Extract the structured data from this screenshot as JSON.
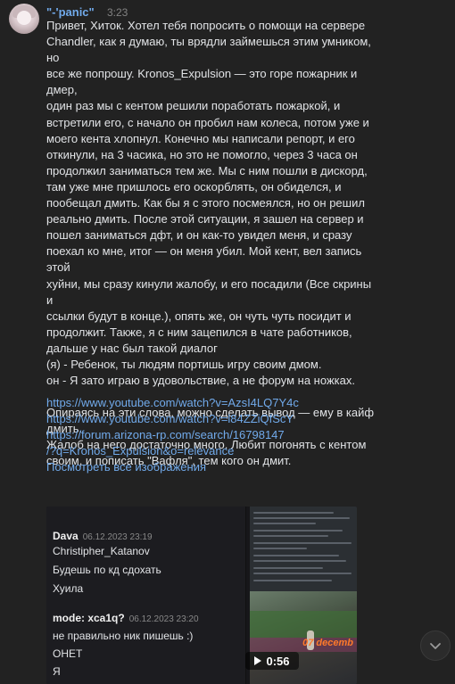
{
  "message": {
    "author": "\"-'panic\"",
    "time": "3:23",
    "paragraphs": [
      "Привет, Хиток. Хотел тебя попросить о помощи на сервере\nChandler, как я думаю, ты врядли займешься этим умником, но\nвсе же попрошу. Kronos_Expulsion — это горе пожарник и дмер,\nодин раз мы с кентом решили поработать пожаркой, и\nвстретили его, с начало он пробил нам колеса, потом уже и\nмоего кента хлопнул. Конечно мы написали репорт, и его\nоткинули, на 3 часика, но это не помогло, через 3 часа он\nпродолжил заниматься тем же. Мы с ним пошли в дискорд,\nтам уже мне пришлось его оскорблять, он обиделся, и\nпообещал дмить. Как бы я с этого посмеялся, но он решил\nреально дмить. После этой ситуации, я зашел на сервер и\nпошел заниматься дфт, и он как-то увидел меня, и сразу\nпоехал ко мне, итог — он меня убил. Мой кент, вел запись этой\nхуйни, мы сразу кинули жалобу, и его посадили (Все скрины и\nссылки будут в конце.), опять же, он чуть чуть посидит и\nпродолжит. Также, я с ним зацепился в чате работников,\nдальше у нас был такой диалог\n(я) - Ребенок, ты людям портишь игру своим дмом.\nон - Я зато играю в удовольствие, а не форум на ножках.",
      "Опираясь на эти слова, можно сделать вывод — ему в кайф\nдмить.\nЖалоб на него достаточно много. Любит погонять с кентом\nсвоим, и пописать \"Вафля\", тем кого он дмит."
    ],
    "links": [
      "https://www.youtube.com/watch?v=AzsI4LQ7Y4c",
      "https://www.youtube.com/watch?v=l84ZZiQfScY",
      "https://forum.arizona-rp.com/search/16798147",
      "/?q=Kronos_Expulsion&o=relevance",
      "Посмотреть все изображения"
    ]
  },
  "attachment": {
    "chat": [
      {
        "name": "Dava",
        "date": "06.12.2023 23:19"
      },
      {
        "text": "Christipher_Katanov"
      },
      {
        "text": "Будешь по кд сдохать"
      },
      {
        "text": "Хуила"
      },
      {
        "name": "mode: xca1q?",
        "date": "06.12.2023 23:20"
      },
      {
        "text": "не правильно ник пишешь :)"
      },
      {
        "text": "ОНЕТ"
      },
      {
        "text": "Я"
      }
    ],
    "game_overlay_date": "07 decemb",
    "video_duration": "0:56"
  },
  "colors": {
    "background": "#222222",
    "link": "#71aaeb",
    "text": "#e1e3e6",
    "muted": "#828282"
  },
  "icons": {
    "play": "play-icon",
    "scroll_down": "chevron-down-icon"
  }
}
